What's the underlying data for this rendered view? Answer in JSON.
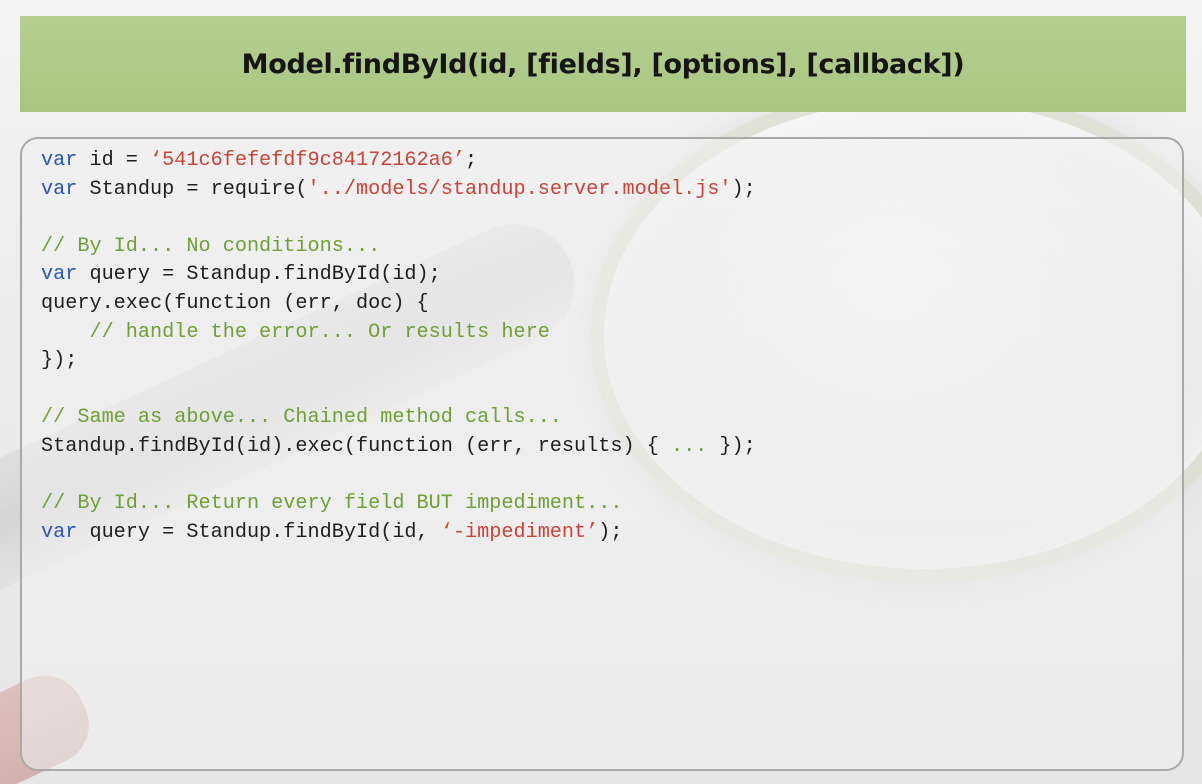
{
  "slide": {
    "title": "Model.findById(id, [fields], [options], [callback])"
  },
  "colors": {
    "title_bar": "#aecb88",
    "keyword": "#2a56b8",
    "string": "#c8443a",
    "comment": "#6fa035",
    "text": "#1e1e1e"
  },
  "code": {
    "lines": [
      [
        {
          "t": "var",
          "c": "kw"
        },
        {
          "t": " id = ",
          "c": "plain"
        },
        {
          "t": "‘541c6fefefdf9c84172162a6’",
          "c": "str"
        },
        {
          "t": ";",
          "c": "plain"
        }
      ],
      [
        {
          "t": "var",
          "c": "kw"
        },
        {
          "t": " Standup = require(",
          "c": "plain"
        },
        {
          "t": "'../models/standup.server.model.js'",
          "c": "str"
        },
        {
          "t": ");",
          "c": "plain"
        }
      ],
      [],
      [
        {
          "t": "// By Id... No conditions...",
          "c": "cmt"
        }
      ],
      [
        {
          "t": "var",
          "c": "kw"
        },
        {
          "t": " query = Standup.findById(id);",
          "c": "plain"
        }
      ],
      [
        {
          "t": "query.exec(function (err, doc) {",
          "c": "plain"
        }
      ],
      [
        {
          "t": "    // handle the error... Or results here",
          "c": "cmt"
        }
      ],
      [
        {
          "t": "});",
          "c": "plain"
        }
      ],
      [],
      [
        {
          "t": "// Same as above... Chained method calls...",
          "c": "cmt"
        }
      ],
      [
        {
          "t": "Standup.findById(id).exec(function (err, results) { ",
          "c": "plain"
        },
        {
          "t": "...",
          "c": "cmt"
        },
        {
          "t": " });",
          "c": "plain"
        }
      ],
      [],
      [
        {
          "t": "// By Id... Return every field BUT impediment...",
          "c": "cmt"
        }
      ],
      [
        {
          "t": "var",
          "c": "kw"
        },
        {
          "t": " query = Standup.findById(id, ",
          "c": "plain"
        },
        {
          "t": "‘-impediment’",
          "c": "str"
        },
        {
          "t": ");",
          "c": "plain"
        }
      ]
    ]
  },
  "decor": {
    "background_icon": "magnifying-glass-icon"
  }
}
